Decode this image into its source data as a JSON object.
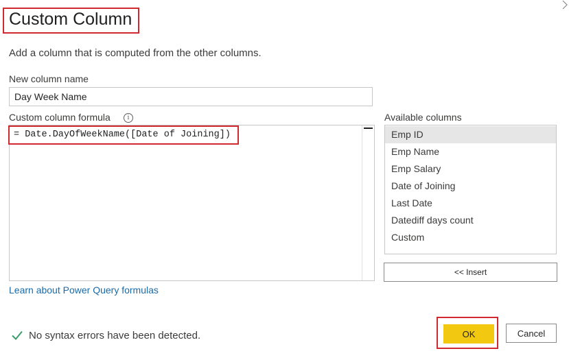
{
  "dialog": {
    "title": "Custom Column",
    "description": "Add a column that is computed from the other columns."
  },
  "new_column": {
    "label": "New column name",
    "value": "Day Week Name"
  },
  "formula": {
    "label": "Custom column formula",
    "info_icon_glyph": "i",
    "value": "= Date.DayOfWeekName([Date of Joining])"
  },
  "available_columns": {
    "label": "Available columns",
    "items": [
      "Emp ID",
      "Emp Name",
      "Emp Salary",
      "Date of Joining",
      "Last Date",
      "Datediff days count",
      "Custom"
    ],
    "selected": "Emp ID"
  },
  "buttons": {
    "insert_label": "<< Insert",
    "ok_label": "OK",
    "cancel_label": "Cancel"
  },
  "link": {
    "learn_label": "Learn about Power Query formulas"
  },
  "status": {
    "message": "No syntax errors have been detected."
  },
  "icons": {
    "close": "close-icon",
    "info": "info-icon",
    "check": "checkmark-icon"
  },
  "colors": {
    "highlight_border": "#d0282e",
    "ok_button": "#f2c811",
    "link": "#1a6aa8",
    "check": "#3a9b6b",
    "selected_item": "#e6e6e6"
  }
}
